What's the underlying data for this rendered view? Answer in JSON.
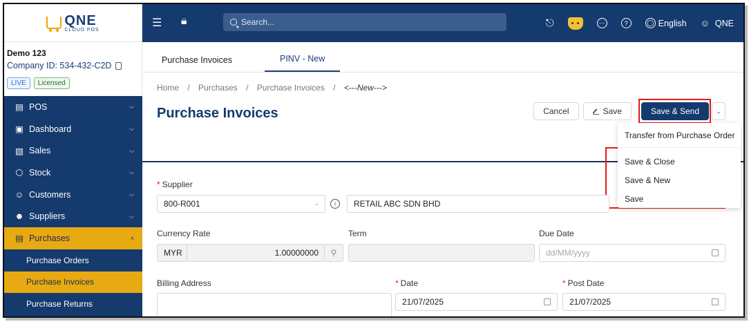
{
  "logo": {
    "brand": "QNE",
    "tagline": "CLOUD POS"
  },
  "company": {
    "name": "Demo 123",
    "id": "Company ID: 534-432-C2D",
    "badges": [
      "LIVE",
      "Licensed"
    ]
  },
  "sidebar": {
    "items": [
      {
        "label": "POS",
        "icon": "cashier-icon",
        "expanded": false
      },
      {
        "label": "Dashboard",
        "icon": "dashboard-icon",
        "expanded": false
      },
      {
        "label": "Sales",
        "icon": "cart-icon",
        "expanded": false
      },
      {
        "label": "Stock",
        "icon": "box-icon",
        "expanded": false
      },
      {
        "label": "Customers",
        "icon": "customers-icon",
        "expanded": false
      },
      {
        "label": "Suppliers",
        "icon": "supplier-icon",
        "expanded": false
      },
      {
        "label": "Purchases",
        "icon": "purchase-icon",
        "expanded": true
      }
    ],
    "subitems": [
      "Purchase Orders",
      "Purchase Invoices",
      "Purchase Returns"
    ]
  },
  "topbar": {
    "search_placeholder": "Search...",
    "language": "English",
    "user": "QNE"
  },
  "tabs": [
    "Purchase Invoices",
    "PINV - New"
  ],
  "breadcrumb": [
    "Home",
    "/",
    "Purchases",
    "/",
    "Purchase Invoices",
    "/",
    "<---New--->"
  ],
  "page_title": "Purchase Invoices",
  "actions": {
    "cancel": "Cancel",
    "save": "Save",
    "save_send": "Save & Send"
  },
  "dropdown": {
    "items": [
      "Transfer from Purchase Order",
      "Save & Close",
      "Save & New",
      "Save"
    ]
  },
  "form": {
    "supplier_label": "Supplier",
    "supplier_code": "800-R001",
    "supplier_name": "RETAIL ABC SDN BHD",
    "currency_rate_label": "Currency Rate",
    "currency": "MYR",
    "rate": "1.00000000",
    "term_label": "Term",
    "term_value": "",
    "due_date_label": "Due Date",
    "due_date_placeholder": "dd/MM/yyyy",
    "billing_address_label": "Billing Address",
    "date_label": "Date",
    "date_value": "21/07/2025",
    "post_date_label": "Post Date",
    "post_date_value": "21/07/2025"
  },
  "colors": {
    "navy": "#153a6e",
    "accent": "#e8aa12",
    "highlight": "#e31b1b"
  }
}
